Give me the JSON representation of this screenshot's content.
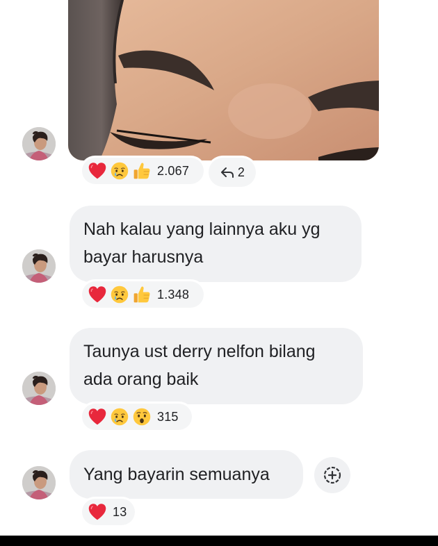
{
  "messages": [
    {
      "type": "photo",
      "reactions": {
        "emojis": [
          "heart",
          "crying-face",
          "thumbs-up"
        ],
        "count": "2.067"
      },
      "replies": {
        "count": "2"
      }
    },
    {
      "text_line1": "Nah kalau yang lainnya aku yg",
      "text_line2": "bayar harusnya",
      "reactions": {
        "emojis": [
          "heart",
          "crying-face",
          "thumbs-up"
        ],
        "count": "1.348"
      }
    },
    {
      "text_line1": "Taunya ust derry nelfon bilang",
      "text_line2": "ada orang baik",
      "reactions": {
        "emojis": [
          "heart",
          "crying-face",
          "surprised-face"
        ],
        "count": "315"
      }
    },
    {
      "text_line1": "Yang bayarin semuanya",
      "reactions": {
        "emojis": [
          "heart"
        ],
        "count": "13"
      }
    }
  ],
  "colors": {
    "bubble": "#f0f1f3",
    "heart": "#e8283c",
    "emoji_yellow": "#ffc83d"
  }
}
